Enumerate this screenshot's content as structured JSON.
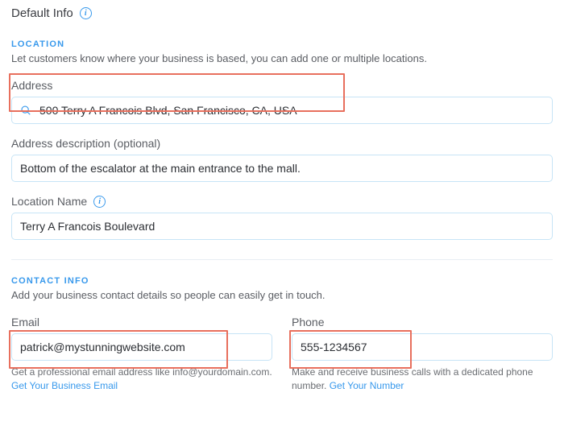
{
  "header": {
    "default_info": "Default Info"
  },
  "location": {
    "heading": "LOCATION",
    "sub": "Let customers know where your business is based, you can add one or multiple locations.",
    "address_label": "Address",
    "address_value": "500 Terry A Francois Blvd, San Francisco, CA, USA",
    "desc_label": "Address description (optional)",
    "desc_value": "Bottom of the escalator at the main entrance to the mall.",
    "name_label": "Location Name",
    "name_value": "Terry A Francois Boulevard"
  },
  "contact": {
    "heading": "CONTACT INFO",
    "sub": "Add your business contact details so people can easily get in touch.",
    "email_label": "Email",
    "email_value": "patrick@mystunningwebsite.com",
    "email_help_pre": "Get a professional email address like info@yourdomain.com. ",
    "email_help_link": "Get Your Business Email",
    "phone_label": "Phone",
    "phone_value": "555-1234567",
    "phone_help_pre": "Make and receive business calls with a dedicated phone number. ",
    "phone_help_link": "Get Your Number"
  }
}
